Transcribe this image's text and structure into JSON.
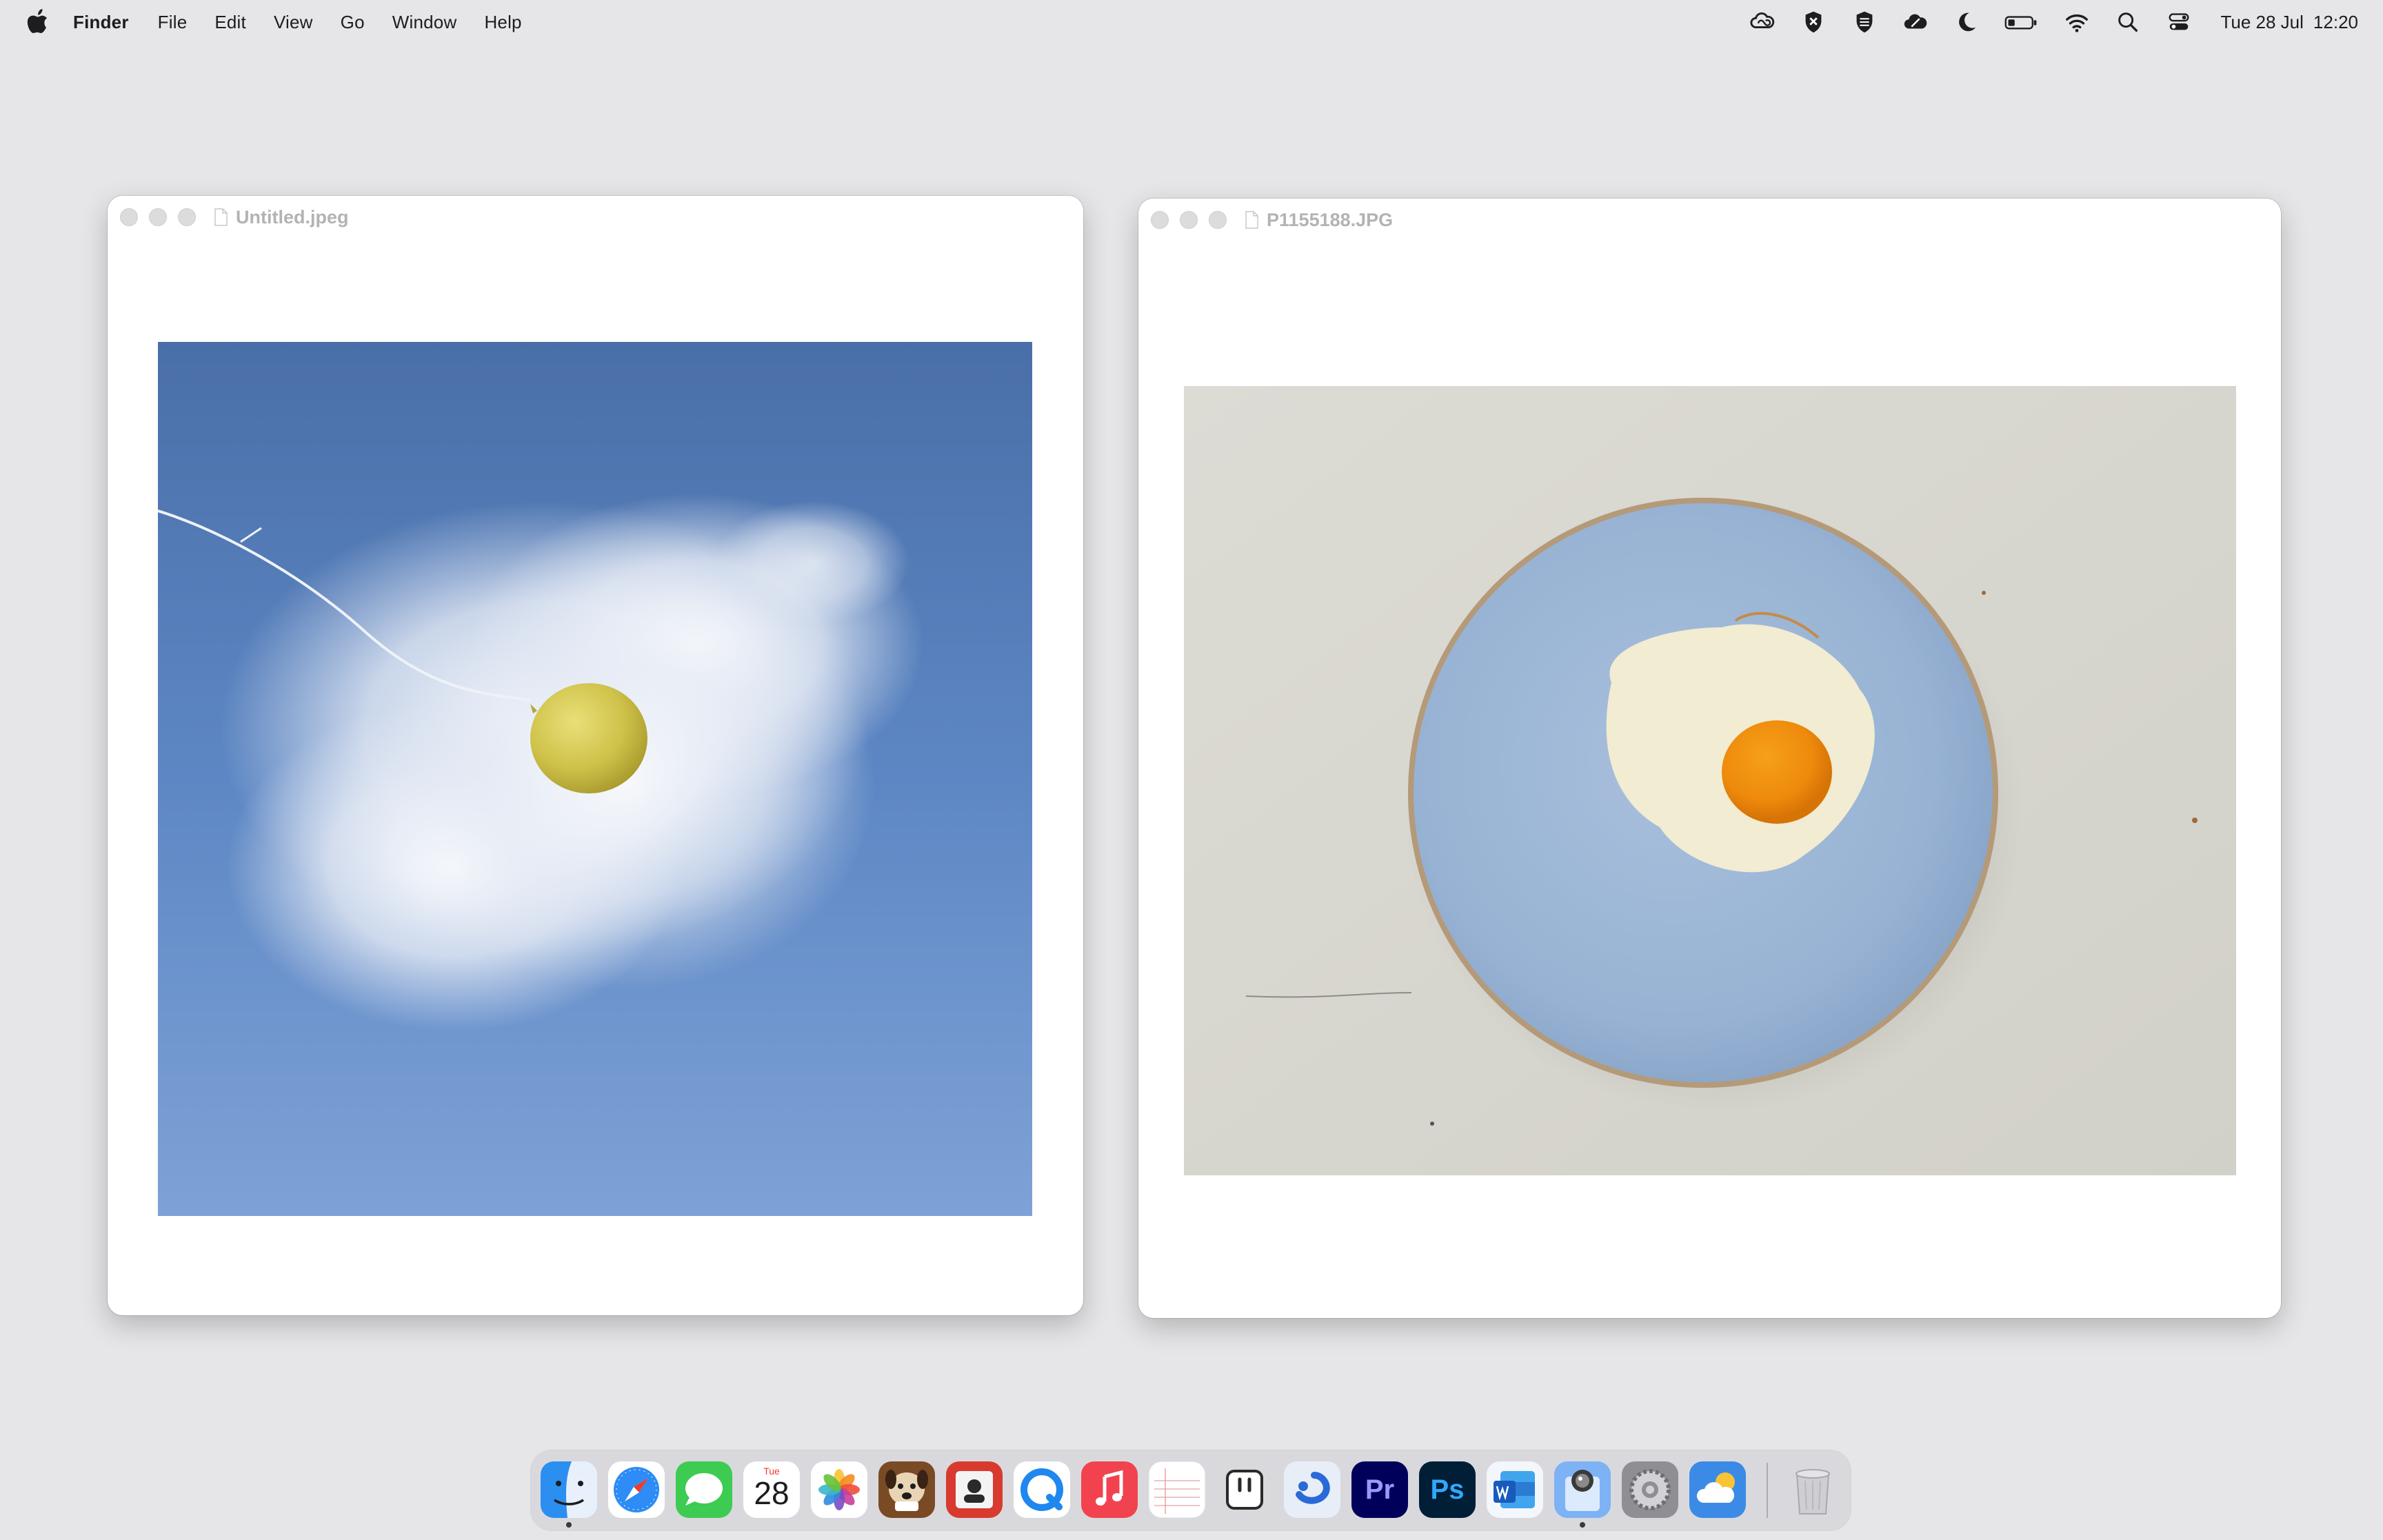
{
  "menubar": {
    "app_name": "Finder",
    "items": [
      "File",
      "Edit",
      "View",
      "Go",
      "Window",
      "Help"
    ],
    "status_icons": [
      "creative-cloud-icon",
      "shield-x-icon",
      "vpn-icon",
      "cloud-sync-icon",
      "moon-icon",
      "battery-icon",
      "wifi-icon",
      "search-icon",
      "control-center-icon"
    ],
    "date": "Tue 28 Jul",
    "time": "12:20"
  },
  "windows": [
    {
      "title": "Untitled.jpeg",
      "image": "yellow-balloon-in-blue-sky-photo"
    },
    {
      "title": "P1155188.JPG",
      "image": "fried-egg-on-blue-plate-photo"
    }
  ],
  "dock": {
    "apps": [
      {
        "name": "Finder",
        "icon": "finder-icon",
        "running": true
      },
      {
        "name": "Safari",
        "icon": "safari-icon"
      },
      {
        "name": "Messages",
        "icon": "messages-icon"
      },
      {
        "name": "Calendar",
        "icon": "calendar-icon",
        "day_label": "Tue",
        "day_number": "28"
      },
      {
        "name": "Photos",
        "icon": "photos-icon"
      },
      {
        "name": "Game",
        "icon": "dog-game-icon"
      },
      {
        "name": "Photo Booth",
        "icon": "photo-booth-icon"
      },
      {
        "name": "QuickTime",
        "icon": "quicktime-icon"
      },
      {
        "name": "Music",
        "icon": "music-icon"
      },
      {
        "name": "Notes",
        "icon": "notes-icon"
      },
      {
        "name": "Notchmeister",
        "icon": "notch-app-icon"
      },
      {
        "name": "Setapp",
        "icon": "blue-app-icon"
      },
      {
        "name": "Premiere Pro",
        "icon": "premiere-icon",
        "label": "Pr"
      },
      {
        "name": "Photoshop",
        "icon": "photoshop-icon",
        "label": "Ps"
      },
      {
        "name": "Word",
        "icon": "word-icon"
      },
      {
        "name": "Preview",
        "icon": "preview-icon",
        "running": true
      },
      {
        "name": "System Settings",
        "icon": "settings-icon"
      },
      {
        "name": "Weather",
        "icon": "weather-icon"
      }
    ],
    "trash": {
      "name": "Trash",
      "icon": "trash-icon"
    }
  }
}
